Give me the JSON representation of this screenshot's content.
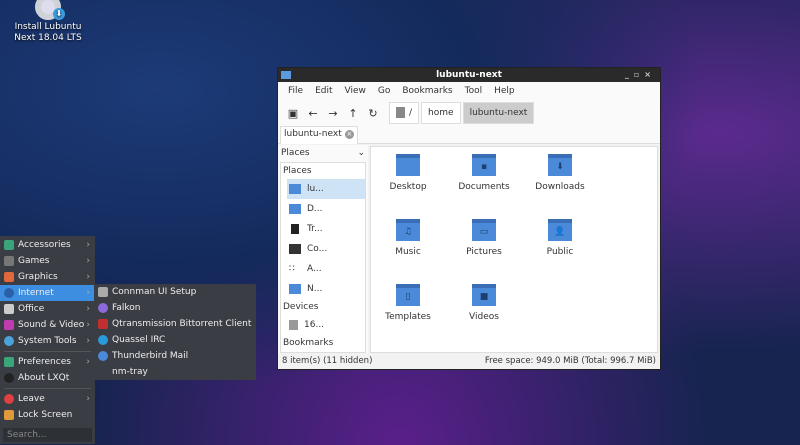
{
  "desktop": {
    "icon_label_1": "Install Lubuntu",
    "icon_label_2": "Next 18.04 LTS"
  },
  "window": {
    "title": "lubuntu-next",
    "menu": [
      "File",
      "Edit",
      "View",
      "Go",
      "Bookmarks",
      "Tool",
      "Help"
    ],
    "breadcrumbs": [
      "/",
      "home",
      "lubuntu-next"
    ],
    "tab": "lubuntu-next",
    "sidebar": {
      "dropdown": "Places",
      "places_header": "Places",
      "places": [
        "lu...",
        "D...",
        "Tr...",
        "Co...",
        "A...",
        "N..."
      ],
      "devices_header": "Devices",
      "devices": [
        "16..."
      ],
      "bookmarks_header": "Bookmarks"
    },
    "files": [
      {
        "name": "Desktop",
        "glyph": ""
      },
      {
        "name": "Documents",
        "glyph": "▪"
      },
      {
        "name": "Downloads",
        "glyph": "⬇"
      },
      {
        "name": "Music",
        "glyph": "♫"
      },
      {
        "name": "Pictures",
        "glyph": "▭"
      },
      {
        "name": "Public",
        "glyph": "👤"
      },
      {
        "name": "Templates",
        "glyph": "▯"
      },
      {
        "name": "Videos",
        "glyph": "■"
      }
    ],
    "status_left": "8 item(s) (11 hidden)",
    "status_right": "Free space: 949.0 MiB (Total: 996.7 MiB)"
  },
  "menu": {
    "items": [
      {
        "label": "Accessories",
        "color": "#3aa57a"
      },
      {
        "label": "Games",
        "color": "#777"
      },
      {
        "label": "Graphics",
        "color": "#e0683a"
      },
      {
        "label": "Internet",
        "color": "#2b5fa8"
      },
      {
        "label": "Office",
        "color": "#ccc"
      },
      {
        "label": "Sound & Video",
        "color": "#c03ab0"
      },
      {
        "label": "System Tools",
        "color": "#4aa3d8"
      },
      {
        "label": "Preferences",
        "color": "#3aa57a"
      },
      {
        "label": "About LXQt",
        "color": "#222"
      },
      {
        "label": "Leave",
        "color": "#e04040"
      },
      {
        "label": "Lock Screen",
        "color": "#e09a3a"
      }
    ],
    "search_placeholder": "Search...",
    "submenu": [
      {
        "label": "Connman UI Setup",
        "color": "#aaa"
      },
      {
        "label": "Falkon",
        "color": "#8a6ad8"
      },
      {
        "label": "Qtransmission Bittorrent Client",
        "color": "#c03030"
      },
      {
        "label": "Quassel IRC",
        "color": "#2a9ad8"
      },
      {
        "label": "Thunderbird Mail",
        "color": "#4a8ad8"
      },
      {
        "label": "nm-tray",
        "color": "#3a3d44"
      }
    ]
  }
}
